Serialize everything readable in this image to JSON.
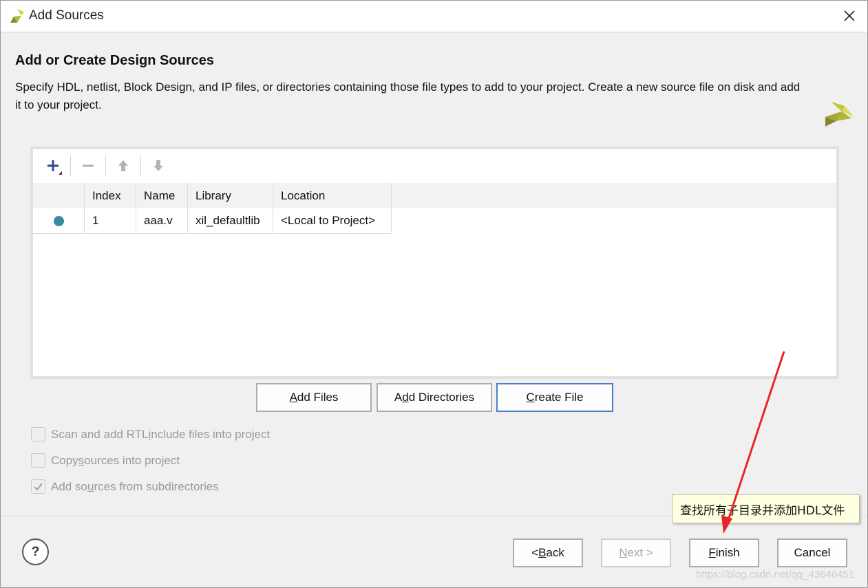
{
  "window": {
    "title": "Add Sources"
  },
  "header": {
    "title": "Add or Create Design Sources",
    "description": "Specify HDL, netlist, Block Design, and IP files, or directories containing those file types to add to your project. Create a new source file on disk and add it to your project."
  },
  "toolbar": {
    "icons": [
      "add-icon",
      "remove-icon",
      "move-up-icon",
      "move-down-icon"
    ]
  },
  "table": {
    "columns": [
      "",
      "Index",
      "Name",
      "Library",
      "Location"
    ],
    "rows": [
      {
        "status": "dot",
        "index": "1",
        "name": "aaa.v",
        "library": "xil_defaultlib",
        "location": "<Local to Project>"
      }
    ]
  },
  "actions": {
    "add_files_pre": "",
    "add_files_u": "A",
    "add_files_post": "dd Files",
    "add_dirs_pre": "A",
    "add_dirs_u": "d",
    "add_dirs_post": "d Directories",
    "create_file_pre": "",
    "create_file_u": "C",
    "create_file_post": "reate File"
  },
  "options": [
    {
      "pre": "Scan and add RTL ",
      "u": "i",
      "post": "nclude files into project",
      "checked": false
    },
    {
      "pre": "Copy ",
      "u": "s",
      "post": "ources into project",
      "checked": false
    },
    {
      "pre": "Add so",
      "u": "u",
      "post": "rces from subdirectories",
      "checked": true
    }
  ],
  "footer": {
    "help": "?",
    "back_pre": "< ",
    "back_u": "B",
    "back_post": "ack",
    "next_u": "N",
    "next_post": "ext >",
    "finish_u": "F",
    "finish_post": "inish",
    "cancel": "Cancel"
  },
  "tooltip": "查找所有子目录并添加HDL文件",
  "watermark": "https://blog.csdn.net/qq_43646451",
  "colors": {
    "accent_blue": "#4a7fc8",
    "annotation_red": "#e8262a",
    "status_dot": "#3b8aa0",
    "xilinx_yellow": "#b5b53a"
  }
}
